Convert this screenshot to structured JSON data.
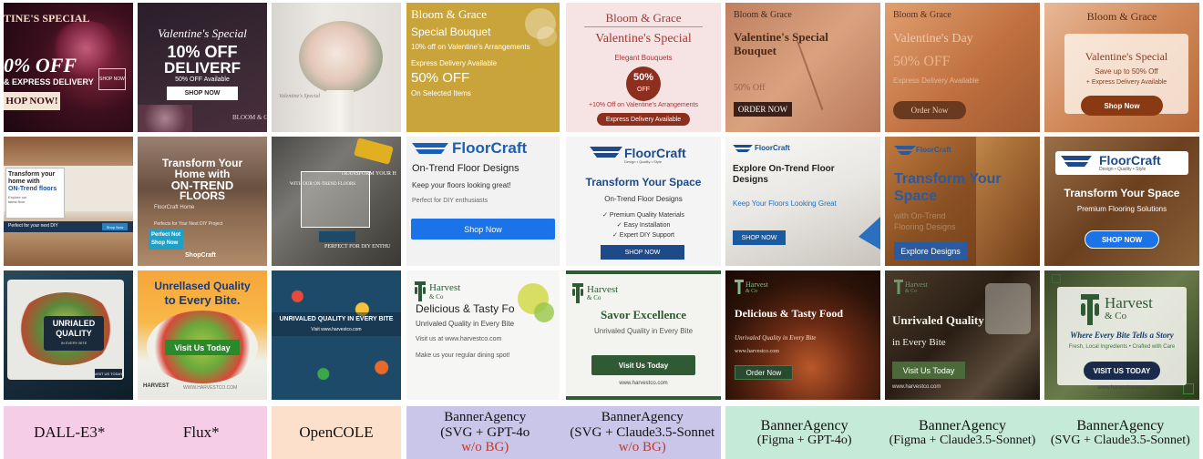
{
  "colors": {
    "label_pink": "#f6cde6",
    "label_peach": "#fde0cc",
    "label_lavender": "#c9c6ea",
    "label_mint": "#c6ead8",
    "wob_red": "#c0392b"
  },
  "row1": {
    "c0": {
      "title": "TINE'S SPECIAL",
      "pct": "0% OFF",
      "delivery": "& EXPRESS DELIVERY",
      "shop": "HOP NOW!",
      "badge": "SHOP NOW"
    },
    "c1": {
      "title": "Valentine's Special",
      "offer": "10% OFF",
      "delivery": "DELIVERF",
      "available": "50% OFF Available",
      "shop": "SHOP NOW",
      "brand": "BLOOM & Grace"
    },
    "c2": {
      "caption": "Valentine's Special"
    },
    "c3": {
      "brand": "Bloom & Grace",
      "title": "Special Bouquet",
      "line1": "10% off on Valentine's Arrangements",
      "line2": "Express Delivery Available",
      "offer": "50% OFF",
      "line3": "On Selected Items"
    },
    "c4": {
      "brand": "Bloom & Grace",
      "title": "Valentine's Special",
      "sub": "Elegant Bouquets",
      "pct": "50%",
      "off": "OFF",
      "line": "+10% Off on Valentine's Arrangements",
      "btn": "Express Delivery Available"
    },
    "c5": {
      "brand": "Bloom & Grace",
      "title1": "Valentine's Special",
      "title2": "Bouquet",
      "off": "50% Off",
      "btn": "ORDER NOW"
    },
    "c6": {
      "brand": "Bloom & Grace",
      "title": "Valentine's Day",
      "offer": "50% OFF",
      "line": "Express Delivery Available",
      "btn": "Order Now"
    },
    "c7": {
      "brand": "Bloom & Grace",
      "title": "Valentine's Special",
      "line1": "Save up to 50% Off",
      "line2": "+ Express Delivery Available",
      "btn": "Shop Now"
    }
  },
  "row2": {
    "c0": {
      "h1": "Transform your",
      "h2": "home with",
      "h3": "ON-Trend floors",
      "p1": "Explore our",
      "p2": "latest floor",
      "bar": "Perfect for your next DIY",
      "btn": "Shop Now"
    },
    "c1": {
      "h1": "Transform Your",
      "h2": "Home with",
      "h3": "ON-TREND",
      "h4": "FLOORS",
      "brand": "FloorCraft Home",
      "sub": "Perfects for Your Next DIY Project",
      "b1": "Perfect Not",
      "b2": "Shop Now",
      "logo": "ShopCraft"
    },
    "c2": {
      "top": "TRANSFORM YOUR H",
      "mid": "WITH OUR ON-TREND FLOORS",
      "bottom": "PERFECT FOR DIY ENTHU"
    },
    "c3": {
      "brand": "FloorCraft",
      "title": "On-Trend Floor Designs",
      "line1": "Keep your floors looking great!",
      "line2": "Perfect for DIY enthusiasts",
      "btn": "Shop Now"
    },
    "c4": {
      "brand": "FloorCraft",
      "tag": "Design • Quality • Style",
      "title": "Transform Your Space",
      "sub": "On-Trend Floor Designs",
      "items": [
        "✓ Premium Quality Materials",
        "✓ Easy Installation",
        "✓ Expert DIY Support"
      ],
      "btn": "SHOP NOW"
    },
    "c5": {
      "brand": "FloorCraft",
      "title1": "Explore On-Trend Floor",
      "title2": "Designs",
      "sub": "Keep Your Floors Looking Great",
      "btn": "SHOP NOW"
    },
    "c6": {
      "brand": "FloorCraft",
      "title1": "Transform Your",
      "title2": "Space",
      "sub1": "with On-Trend",
      "sub2": "Flooring Designs",
      "btn": "Explore Designs"
    },
    "c7": {
      "brand": "FloorCraft",
      "tag": "Design • Quality • Style",
      "title": "Transform Your Space",
      "sub": "Premium Flooring Solutions",
      "btn": "SHOP NOW"
    }
  },
  "row3": {
    "c0": {
      "l1": "UNRIALED",
      "l2": "QUALITY",
      "l3": "IN EVERY BITE",
      "btn": "VISIT US TODAY"
    },
    "c1": {
      "t1": "Unrellased Quality",
      "t2": "to Every Bite.",
      "btn": "Visit Us Today",
      "brand": "HARVEST",
      "url": "WWW.HARVESTCO.COM"
    },
    "c2": {
      "title": "UNRIVALED QUALITY IN EVERY BITE",
      "url": "Visit www.harvestco.com"
    },
    "c3": {
      "brand": "Harvest",
      "co": "& Co",
      "title": "Delicious & Tasty Fo",
      "line1": "Unrivaled Quality in Every Bite",
      "line2": "Visit us at www.harvestco.com",
      "line3": "Make us your regular dining spot!"
    },
    "c4": {
      "brand": "Harvest",
      "co": "& Co",
      "title": "Savor Excellence",
      "sub": "Unrivaled Quality in Every Bite",
      "btn": "Visit Us Today",
      "url": "www.harvestco.com"
    },
    "c5": {
      "brand": "Harvest",
      "co": "& Co",
      "title": "Delicious & Tasty Food",
      "sub": "Unrivaled Quality in Every Bite",
      "url": "www.harvestco.com",
      "btn": "Order Now"
    },
    "c6": {
      "brand": "Harvest",
      "co": "& Co",
      "title": "Unrivaled Quality",
      "sub": "in Every Bite",
      "btn": "Visit Us Today",
      "url": "www.harvestco.com"
    },
    "c7": {
      "brand": "Harvest",
      "co": "& Co",
      "tagline": "Where Every Bite Tells a Story",
      "sub": "Fresh, Local Ingredients • Crafted with Care",
      "btn": "VISIT US TODAY",
      "url": "www.harvestco.com"
    }
  },
  "labels": {
    "dalle": "DALL-E3*",
    "flux": "Flux*",
    "opencole": "OpenCOLE",
    "ba_gpt_1": "BannerAgency",
    "ba_gpt_2": "(SVG + GPT-4o",
    "ba_gpt_3": "w/o BG)",
    "ba_claude_1": "BannerAgency",
    "ba_claude_2": "(SVG + Claude3.5-Sonnet",
    "ba_claude_3": "w/o BG)",
    "ba_figma_gpt_1": "BannerAgency",
    "ba_figma_gpt_2": "(Figma + GPT-4o)",
    "ba_figma_claude_1": "BannerAgency",
    "ba_figma_claude_2": "(Figma + Claude3.5-Sonnet)",
    "ba_svg_claude_1": "BannerAgency",
    "ba_svg_claude_2": "(SVG + Claude3.5-Sonnet)"
  }
}
